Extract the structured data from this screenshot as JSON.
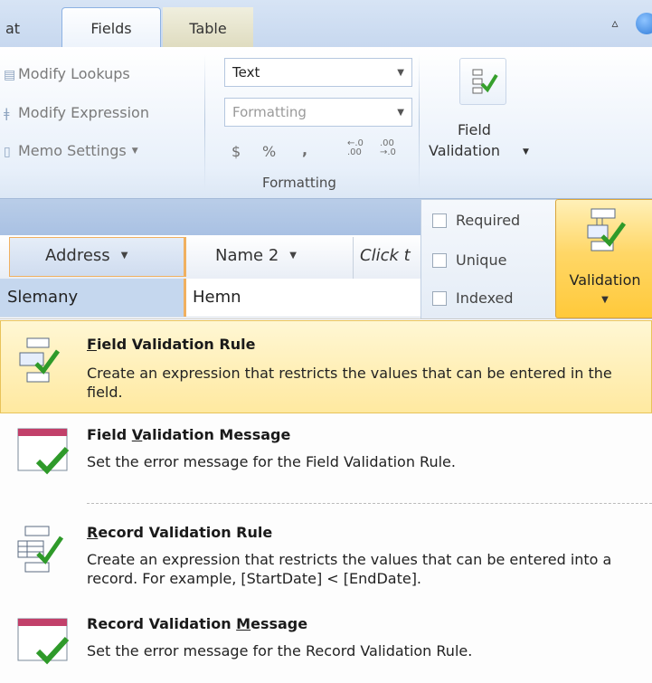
{
  "tabs": {
    "format_partial": "at",
    "fields": "Fields",
    "table": "Table"
  },
  "ribbon": {
    "modify_lookups": "Modify Lookups",
    "modify_expression": "Modify Expression",
    "memo_settings": "Memo Settings",
    "data_type_value": "Text",
    "format_placeholder": "Formatting",
    "currency_symbol": "$",
    "percent_symbol": "%",
    "comma_symbol": ",",
    "increase_decimals": "←.0 .00",
    "decrease_decimals": ".00 →.0",
    "formatting_group_label": "Formatting",
    "field_validation_line1": "Field",
    "field_validation_line2": "Validation"
  },
  "checkboxes": [
    {
      "label": "Required",
      "checked": false
    },
    {
      "label": "Unique",
      "checked": false
    },
    {
      "label": "Indexed",
      "checked": false
    }
  ],
  "validation_button": {
    "label": "Validation"
  },
  "table": {
    "headers": [
      "Address",
      "Name 2",
      "Click t"
    ],
    "row": [
      "Slemany",
      "Hemn"
    ]
  },
  "menu": [
    {
      "title_pre": "",
      "title_key": "F",
      "title_post": "ield Validation Rule",
      "desc": "Create an expression that restricts the values that can be entered in the field.",
      "icon": "field-validation-rule-icon"
    },
    {
      "title_pre": "Field ",
      "title_key": "V",
      "title_post": "alidation Message",
      "desc": "Set the error message for the Field Validation Rule.",
      "icon": "field-validation-message-icon"
    },
    {
      "title_pre": "",
      "title_key": "R",
      "title_post": "ecord Validation Rule",
      "desc": "Create an expression that restricts the values that can be entered into a record.  For example, [StartDate] < [EndDate].",
      "icon": "record-validation-rule-icon"
    },
    {
      "title_pre": "Record Validation ",
      "title_key": "M",
      "title_post": "essage",
      "desc": "Set the error message for the Record Validation Rule.",
      "icon": "record-validation-message-icon"
    }
  ],
  "colors": {
    "highlight": "#ffe9a0",
    "ribbon": "#e8f0fa",
    "accent_border": "#f0b060"
  }
}
